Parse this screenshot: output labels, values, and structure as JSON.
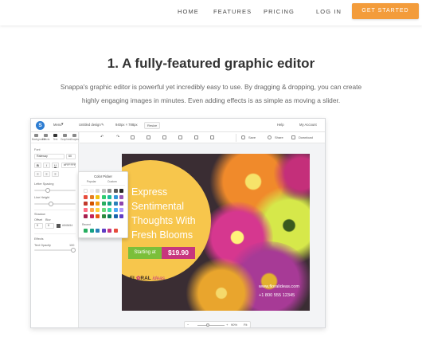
{
  "nav": {
    "items": [
      "HOME",
      "FEATURES",
      "PRICING",
      "LOG IN"
    ],
    "cta": "GET STARTED",
    "accent": "#f39c3b"
  },
  "hero": {
    "title": "1. A fully-featured graphic editor",
    "paragraph_lines": [
      "Snappa's graphic editor is powerful yet incredibly easy to use. By dragging & dropping, you can create",
      "highly engaging images in minutes. Even adding effects is as simple as moving a slider."
    ]
  },
  "editor": {
    "topbar": {
      "logo": "S",
      "menu": "Menu",
      "doc_name": "Untitled design",
      "size": "940px × 788px",
      "resize": "Resize",
      "help": "Help",
      "account": "My Account"
    },
    "tool_tabs": [
      "Background",
      "Effects",
      "Text",
      "Graphics",
      "Shapes"
    ],
    "sidebar": {
      "font_label": "Font",
      "font_name": "Raleway",
      "font_size": "60",
      "style_buttons": [
        "B",
        "I",
        "U"
      ],
      "color_value": "#FFFFFF",
      "letter_spacing_label": "Letter Spacing",
      "line_height_label": "Line Height",
      "shadow_label": "Shadow",
      "offset_label": "Offset",
      "blur_label": "Blur",
      "offset_value": "0",
      "blur_value": "0",
      "shadow_color": "#545454",
      "effects_label": "Effects",
      "text_opacity_label": "Text Opacity",
      "text_opacity_value": "100"
    },
    "toolbar": {
      "save": "Save",
      "share": "Share",
      "download": "Download"
    },
    "color_picker": {
      "title": "Color Picker",
      "tabs": [
        "Popular",
        "Custom"
      ],
      "recent_label": "Recent",
      "swatches": [
        [
          "#ffffff",
          "#f2f2f2",
          "#d9d9d9",
          "#bfbfbf",
          "#8c8c8c",
          "#595959",
          "#262626"
        ],
        [
          "#e74c3c",
          "#e67e22",
          "#f1c40f",
          "#2ecc71",
          "#1abc9c",
          "#3498db",
          "#9b59b6"
        ],
        [
          "#c0392b",
          "#d35400",
          "#f39c12",
          "#27ae60",
          "#16a085",
          "#2980b9",
          "#8e44ad"
        ],
        [
          "#ff6b81",
          "#ffa94d",
          "#ffd43b",
          "#69db7c",
          "#38d9a9",
          "#4dabf7",
          "#b197fc"
        ],
        [
          "#a61e4d",
          "#c2255c",
          "#e8590c",
          "#2b8a3e",
          "#087f5b",
          "#1864ab",
          "#5f3dc4"
        ]
      ],
      "recent": [
        "#27ae60",
        "#16a085",
        "#2980b9",
        "#5f3dc4",
        "#c7367e",
        "#e74c3c"
      ]
    },
    "design": {
      "lines": [
        "Express",
        "Sentimental",
        "Thoughts With",
        "Fresh Blooms"
      ],
      "starting_at": "Starting at",
      "price": "$19.90",
      "brand_prefix": "FL",
      "brand_flower": "✿",
      "brand_rest": "RAL",
      "brand_ideas": "ideas",
      "website": "www.floralideas.com",
      "phone": "+1 800 555 12345"
    },
    "zoom": {
      "minus": "−",
      "plus": "+",
      "value": "90%",
      "fit": "Fit"
    }
  }
}
